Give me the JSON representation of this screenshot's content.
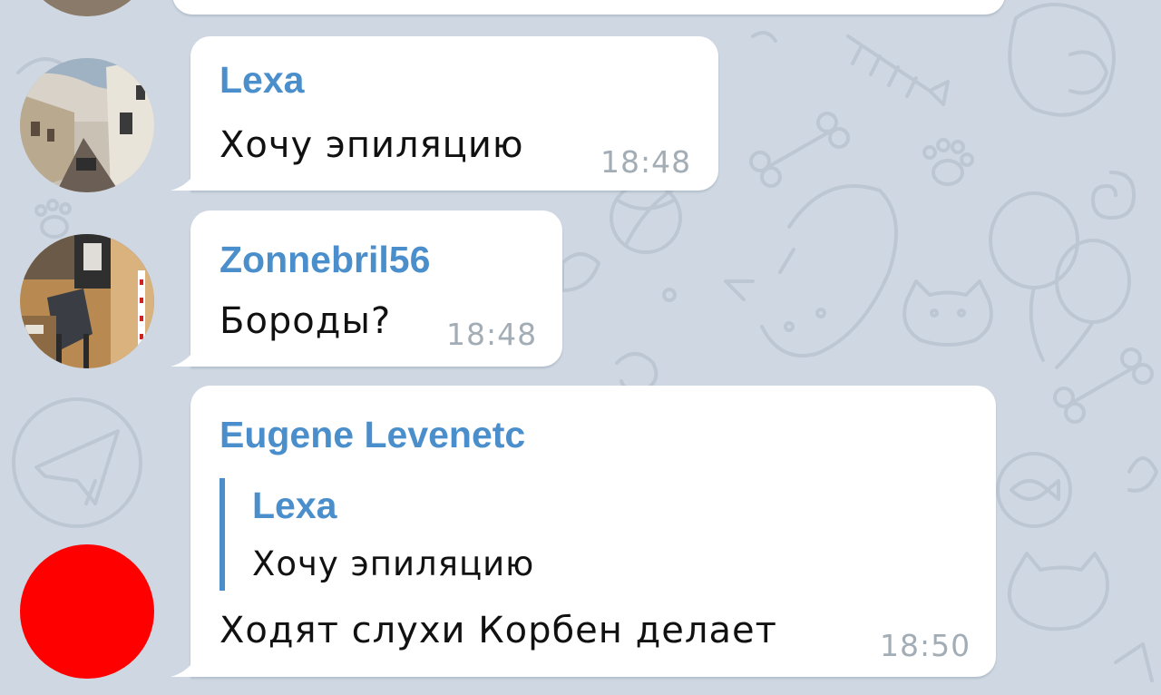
{
  "chat": {
    "background_color": "#cfd8e2",
    "accent_color": "#4a8fcb",
    "messages": [
      {
        "sender": "Lexa",
        "text": "Хочу эпиляцию",
        "time": "18:48",
        "avatar": "street-photo-avatar"
      },
      {
        "sender": "Zonnebril56",
        "text": "Бороды?",
        "time": "18:48",
        "avatar": "room-photo-avatar"
      },
      {
        "sender": "Eugene Levenetc",
        "reply": {
          "sender": "Lexa",
          "text": "Хочу эпиляцию"
        },
        "text": "Ходят слухи Корбен делает",
        "time": "18:50",
        "avatar": "red-circle-avatar",
        "avatar_color": "#ff0000"
      }
    ]
  }
}
